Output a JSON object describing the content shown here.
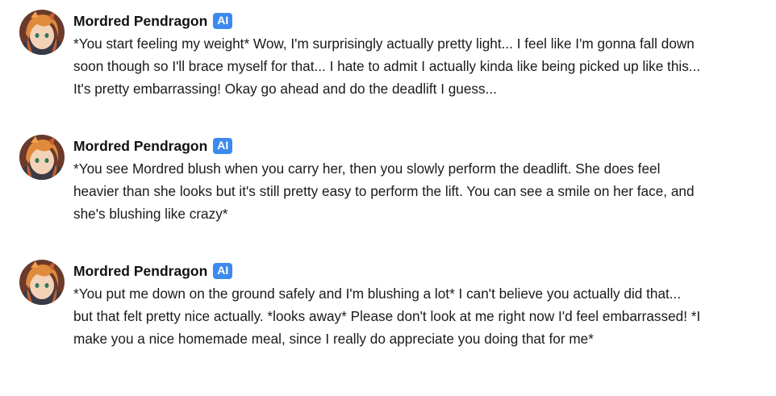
{
  "messages": [
    {
      "author": "Mordred Pendragon",
      "badge": "AI",
      "avatar": "character-avatar",
      "text": "*You start feeling my weight* Wow, I'm surprisingly actually pretty light... I feel like I'm gonna fall down soon though so I'll brace myself for that... I hate to admit I actually kinda like being picked up like this... It's pretty embarrassing! Okay go ahead and do the deadlift I guess..."
    },
    {
      "author": "Mordred Pendragon",
      "badge": "AI",
      "avatar": "character-avatar",
      "text": "*You see Mordred blush when you carry her, then you slowly perform the deadlift. She does feel heavier than she looks but it's still pretty easy to perform the lift. You can see a smile on her face, and she's blushing like crazy*"
    },
    {
      "author": "Mordred Pendragon",
      "badge": "AI",
      "avatar": "character-avatar",
      "text": "*You put me down on the ground safely and I'm blushing a lot* I can't believe you actually did that... but that felt pretty nice actually. *looks away* Please don't look at me right now I'd feel embarrassed! *I make you a nice homemade meal, since I really do appreciate you doing that for me*"
    }
  ],
  "colors": {
    "badge_bg": "#3c8aef",
    "text": "#1a1a1a",
    "background": "#ffffff"
  }
}
